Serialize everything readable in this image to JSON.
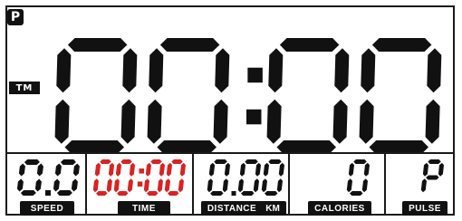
{
  "display": {
    "main_time": "00:00",
    "main_label": "TM",
    "corner_glyph": "P"
  },
  "metrics": [
    {
      "name": "speed",
      "value": "0.0",
      "label": "SPEED"
    },
    {
      "name": "time",
      "value": "00:00",
      "label": "TIME"
    },
    {
      "name": "distance",
      "value": "0.00",
      "label": "DISTANCE",
      "unit": "KM"
    },
    {
      "name": "calories",
      "value": "0",
      "label": "CALORIES"
    },
    {
      "name": "pulse",
      "value": "P",
      "label": "PULSE"
    }
  ],
  "colors": {
    "segment": "#111111",
    "time_segment": "#d92323",
    "label_bg": "#111111",
    "background": "#ffffff"
  }
}
